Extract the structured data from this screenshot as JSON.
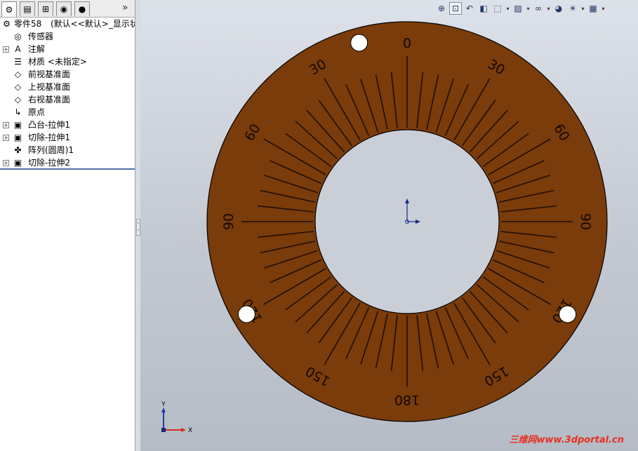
{
  "feature_tree": {
    "tabs": [
      {
        "icon": "feature-manager-icon",
        "symbol": "⚙"
      },
      {
        "icon": "property-manager-icon",
        "symbol": "▤"
      },
      {
        "icon": "configuration-manager-icon",
        "symbol": "⊞"
      },
      {
        "icon": "dimxpert-icon",
        "symbol": "◉"
      },
      {
        "icon": "display-manager-icon",
        "symbol": "●"
      }
    ],
    "more": "»",
    "root": {
      "label": "零件58",
      "config": "(默认<<默认>_显示状态",
      "icon": "part-icon",
      "symbol": "⚙"
    },
    "items": [
      {
        "label": "传感器",
        "icon": "sensor-icon",
        "symbol": "◎",
        "expandable": false
      },
      {
        "label": "注解",
        "icon": "annotation-icon",
        "symbol": "A",
        "expandable": true
      },
      {
        "label": "材质 <未指定>",
        "icon": "material-icon",
        "symbol": "☰",
        "expandable": false
      },
      {
        "label": "前视基准面",
        "icon": "plane-icon",
        "symbol": "◇",
        "expandable": false
      },
      {
        "label": "上视基准面",
        "icon": "plane-icon",
        "symbol": "◇",
        "expandable": false
      },
      {
        "label": "右视基准面",
        "icon": "plane-icon",
        "symbol": "◇",
        "expandable": false
      },
      {
        "label": "原点",
        "icon": "origin-icon",
        "symbol": "↳",
        "expandable": false
      },
      {
        "label": "凸台-拉伸1",
        "icon": "boss-extrude-icon",
        "symbol": "▣",
        "expandable": true
      },
      {
        "label": "切除-拉伸1",
        "icon": "cut-extrude-icon",
        "symbol": "▣",
        "expandable": true
      },
      {
        "label": "阵列(圆周)1",
        "icon": "circular-pattern-icon",
        "symbol": "✤",
        "expandable": false
      },
      {
        "label": "切除-拉伸2",
        "icon": "cut-extrude-icon",
        "symbol": "▣",
        "expandable": true
      }
    ]
  },
  "view_toolbar": [
    {
      "name": "zoom-to-fit-icon",
      "symbol": "⊕",
      "dropdown": false
    },
    {
      "name": "zoom-to-area-icon",
      "symbol": "⊡",
      "dropdown": false,
      "active": true
    },
    {
      "name": "previous-view-icon",
      "symbol": "↶",
      "dropdown": false
    },
    {
      "name": "section-view-icon",
      "symbol": "◧",
      "dropdown": false
    },
    {
      "name": "view-orientation-icon",
      "symbol": "⬚",
      "dropdown": true
    },
    {
      "name": "display-style-icon",
      "symbol": "▨",
      "dropdown": true
    },
    {
      "name": "hide-show-items-icon",
      "symbol": "∞",
      "dropdown": true
    },
    {
      "name": "edit-appearance-icon",
      "symbol": "◕",
      "dropdown": false
    },
    {
      "name": "apply-scene-icon",
      "symbol": "☀",
      "dropdown": true
    },
    {
      "name": "view-settings-icon",
      "symbol": "▦",
      "dropdown": true
    }
  ],
  "dial": {
    "face_color": "#7a3c0a",
    "outline_color": "#000000",
    "tick_color": "#1e0e02",
    "tick_count": 60,
    "scale_labels": [
      "0",
      "30",
      "60",
      "90",
      "120",
      "150",
      "180",
      "150",
      "120",
      "90",
      "60",
      "30"
    ]
  },
  "triad": {
    "x_label": "X",
    "y_label": "Y"
  },
  "watermark": "三维网www.3dportal.cn"
}
